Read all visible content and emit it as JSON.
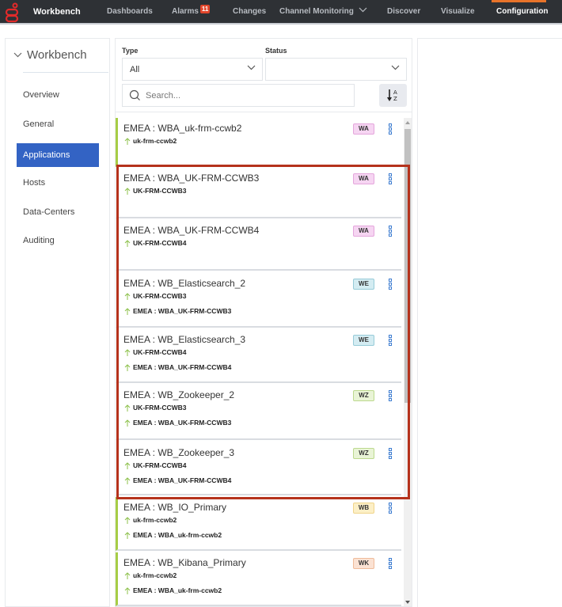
{
  "app": {
    "brand": "Workbench",
    "logo_icon": "genesys-logo-icon"
  },
  "topnav": {
    "items": [
      {
        "label": "Dashboards"
      },
      {
        "label": "Alarms",
        "badge": "11"
      },
      {
        "label": "Changes"
      },
      {
        "label": "Channel Monitoring",
        "has_dropdown": true
      },
      {
        "label": "Discover"
      },
      {
        "label": "Visualize"
      },
      {
        "label": "Configuration",
        "active": true
      }
    ]
  },
  "sidebar": {
    "header": "Workbench",
    "items": [
      {
        "label": "Overview"
      },
      {
        "label": "General"
      },
      {
        "label": "Applications",
        "active": true
      },
      {
        "label": "Hosts"
      },
      {
        "label": "Data-Centers"
      },
      {
        "label": "Auditing"
      }
    ]
  },
  "filters": {
    "type_label": "Type",
    "type_value": "All",
    "status_label": "Status",
    "status_value": "",
    "search_placeholder": "Search...",
    "sort_icon": "sort-alpha-az-icon"
  },
  "colors": {
    "accent_green": "#a7cd45",
    "highlight_red": "#b5321c",
    "active_blue": "#3363c4",
    "nav_orange": "#e8732a",
    "alarm_red": "#e2462b"
  },
  "applications": [
    {
      "title": "EMEA : WBA_uk-frm-ccwb2",
      "badge": "WA",
      "badge_color": "#f6d5f2",
      "badge_border": "#e4a6dc",
      "accent": true,
      "links": [
        "uk-frm-ccwb2"
      ]
    },
    {
      "title": "EMEA : WBA_UK-FRM-CCWB3",
      "badge": "WA",
      "badge_color": "#f6d5f2",
      "badge_border": "#e4a6dc",
      "accent": false,
      "links": [
        "UK-FRM-CCWB3"
      ]
    },
    {
      "title": "EMEA : WBA_UK-FRM-CCWB4",
      "badge": "WA",
      "badge_color": "#f6d5f2",
      "badge_border": "#e4a6dc",
      "accent": false,
      "links": [
        "UK-FRM-CCWB4"
      ]
    },
    {
      "title": "EMEA : WB_Elasticsearch_2",
      "badge": "WE",
      "badge_color": "#d4ecf2",
      "badge_border": "#97cbd8",
      "accent": false,
      "links": [
        "UK-FRM-CCWB3",
        "EMEA : WBA_UK-FRM-CCWB3"
      ]
    },
    {
      "title": "EMEA : WB_Elasticsearch_3",
      "badge": "WE",
      "badge_color": "#d4ecf2",
      "badge_border": "#97cbd8",
      "accent": false,
      "links": [
        "UK-FRM-CCWB4",
        "EMEA : WBA_UK-FRM-CCWB4"
      ]
    },
    {
      "title": "EMEA : WB_Zookeeper_2",
      "badge": "WZ",
      "badge_color": "#e9f4d6",
      "badge_border": "#bcd98e",
      "accent": false,
      "links": [
        "UK-FRM-CCWB3",
        "EMEA : WBA_UK-FRM-CCWB3"
      ]
    },
    {
      "title": "EMEA : WB_Zookeeper_3",
      "badge": "WZ",
      "badge_color": "#e9f4d6",
      "badge_border": "#bcd98e",
      "accent": false,
      "links": [
        "UK-FRM-CCWB4",
        "EMEA : WBA_UK-FRM-CCWB4"
      ]
    },
    {
      "title": "EMEA : WB_IO_Primary",
      "badge": "WB",
      "badge_color": "#fcefc6",
      "badge_border": "#f0d48a",
      "accent": true,
      "links": [
        "uk-frm-ccwb2",
        "EMEA : WBA_uk-frm-ccwb2"
      ]
    },
    {
      "title": "EMEA : WB_Kibana_Primary",
      "badge": "WK",
      "badge_color": "#fbe2d3",
      "badge_border": "#efbb9a",
      "accent": true,
      "links": [
        "uk-frm-ccwb2",
        "EMEA : WBA_uk-frm-ccwb2"
      ]
    }
  ]
}
